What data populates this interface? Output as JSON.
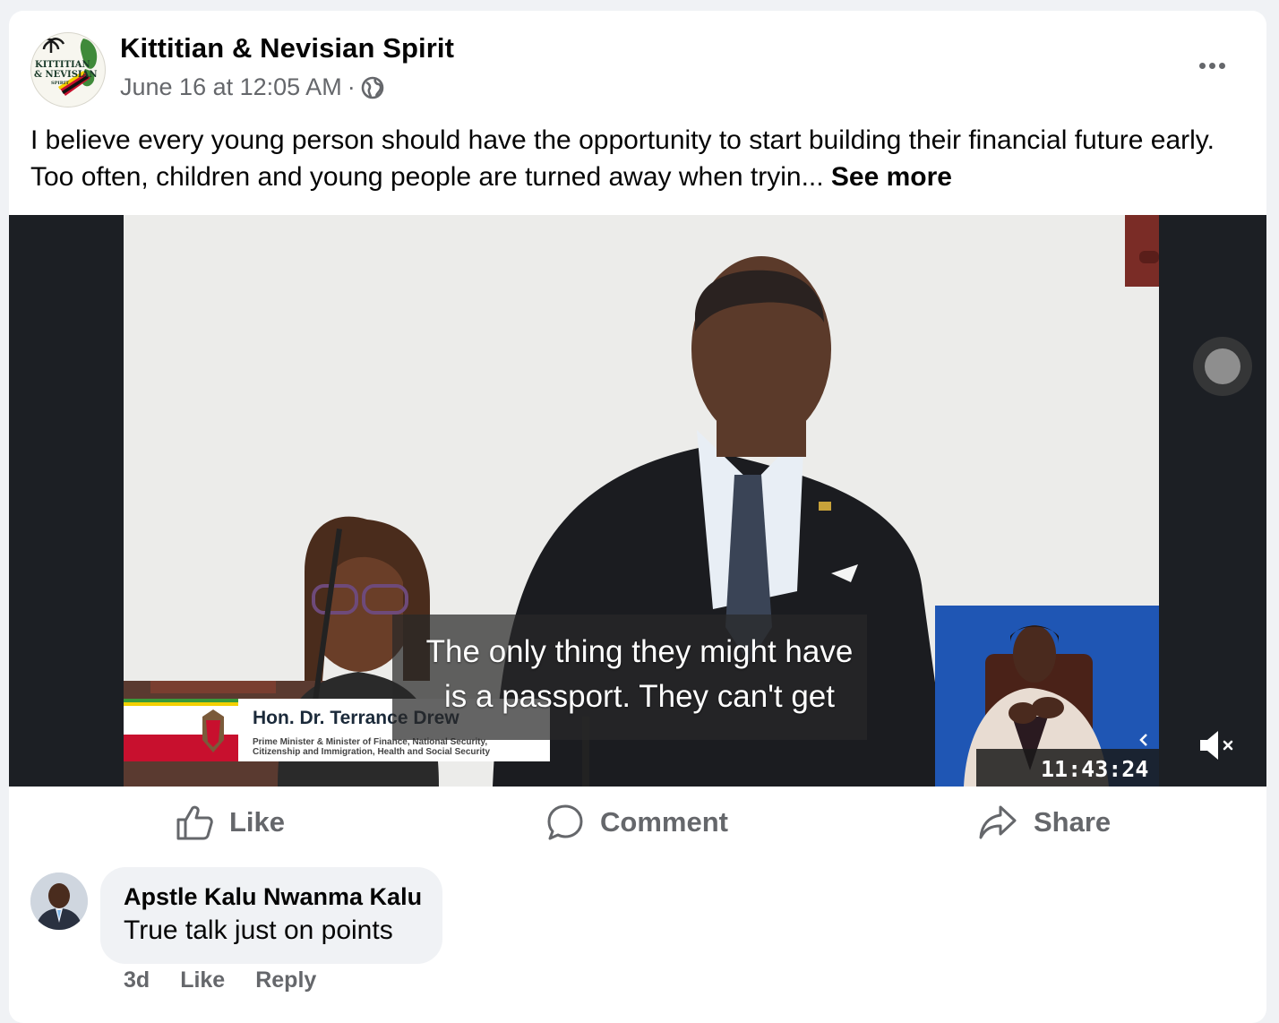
{
  "post": {
    "page_name": "Kittitian & Nevisian Spirit",
    "timestamp": "June 16 at 12:05 AM",
    "separator": "·",
    "privacy_icon": "globe-icon",
    "logo_text_1": "KITTITIAN",
    "logo_text_2": "& NEVISIAN",
    "logo_text_3": "SPIRIT",
    "text": "I believe every young person should have the opportunity to start building their financial future early. Too often, children and young people are turned away when tryin...",
    "see_more": "See more"
  },
  "video": {
    "caption_line_1": "The only thing they might have",
    "caption_line_2": "is a passport. They can't get",
    "lower_third_name": "Hon. Dr. Terrance Drew",
    "lower_third_line_1": "Prime Minister & Minister of Finance, National Security,",
    "lower_third_line_2": "Citizenship and Immigration, Health and Social Security",
    "timer": "11:43:24",
    "mute_icon": "muted-speaker-icon"
  },
  "actions": {
    "like": "Like",
    "comment": "Comment",
    "share": "Share"
  },
  "comment": {
    "author": "Apstle Kalu Nwanma Kalu",
    "text": "True talk just on points",
    "age": "3d",
    "like": "Like",
    "reply": "Reply"
  },
  "colors": {
    "secondary_text": "#65676b",
    "bubble_bg": "#f0f2f5",
    "page_bg": "#f0f2f5"
  }
}
